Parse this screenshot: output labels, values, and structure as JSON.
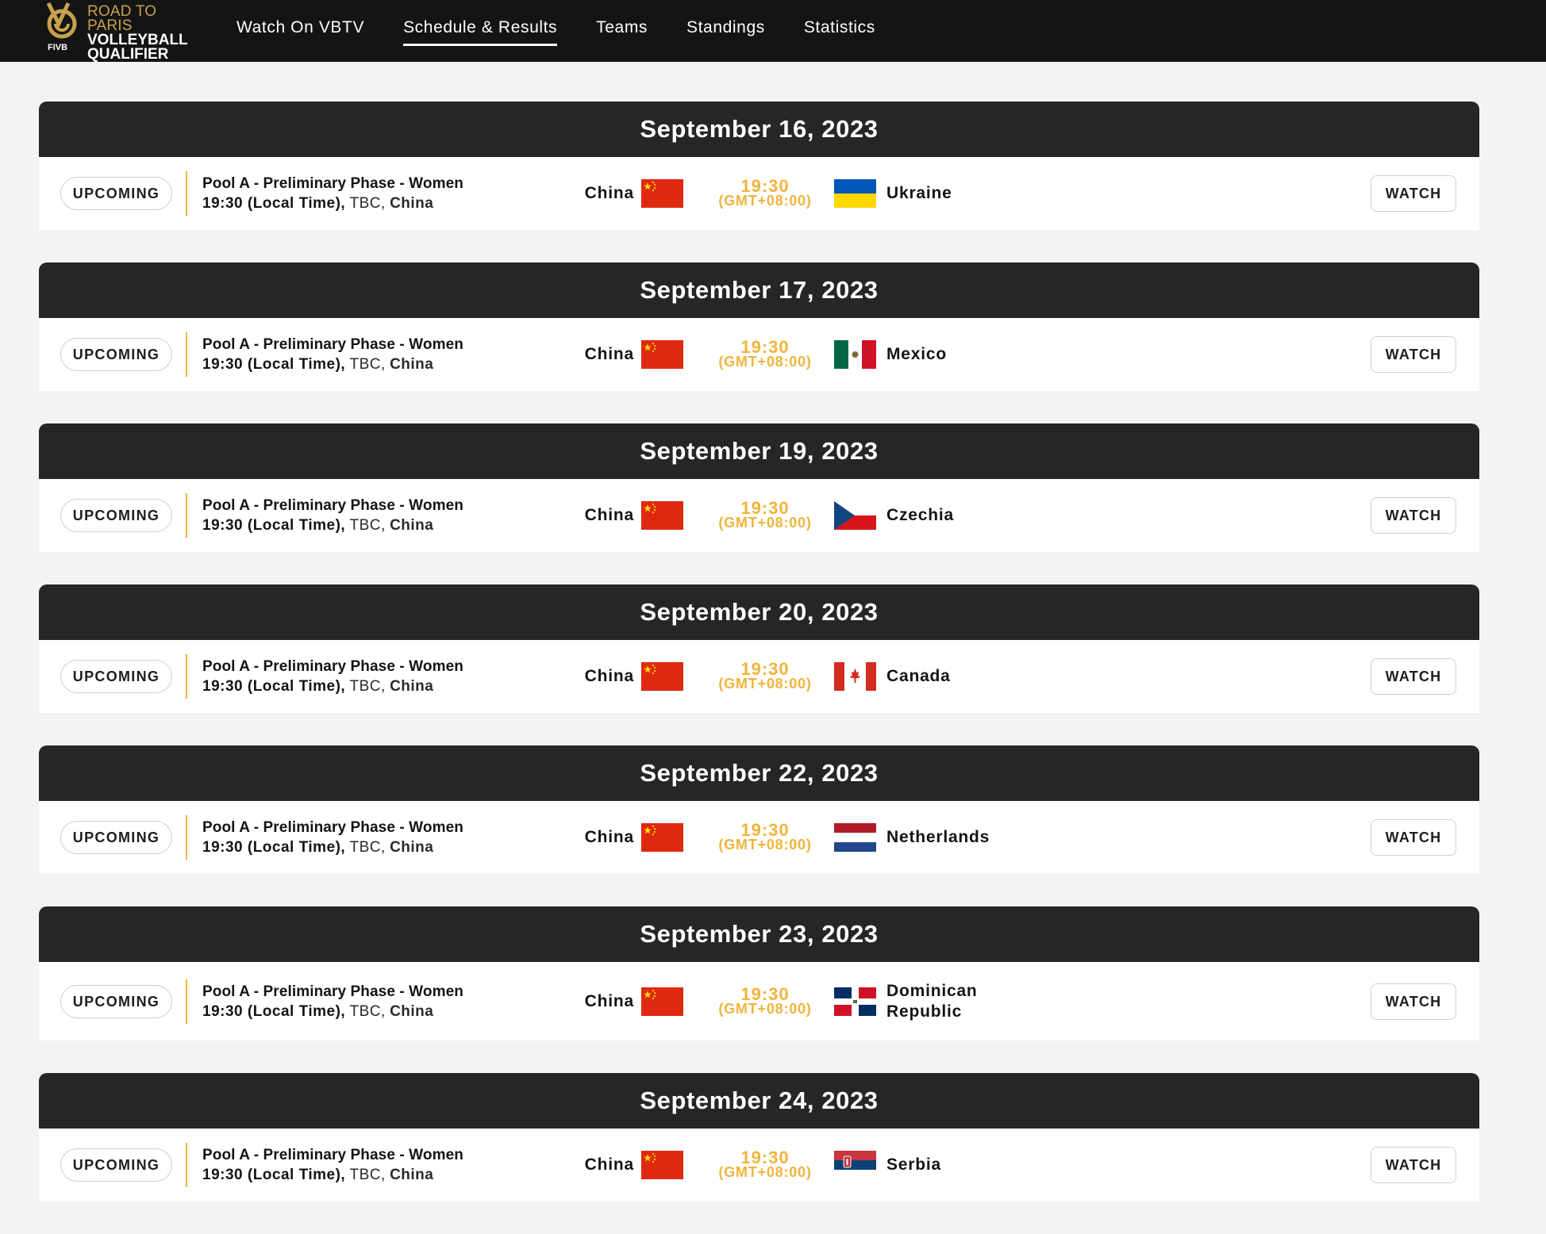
{
  "header": {
    "logo": {
      "line1": "ROAD TO PARIS",
      "line2": "VOLLEYBALL",
      "line3": "QUALIFIER",
      "badge": "FIVB"
    },
    "nav": [
      {
        "label": "Watch On VBTV",
        "active": false
      },
      {
        "label": "Schedule & Results",
        "active": true
      },
      {
        "label": "Teams",
        "active": false
      },
      {
        "label": "Standings",
        "active": false
      },
      {
        "label": "Statistics",
        "active": false
      }
    ]
  },
  "colors": {
    "accent": "#f0b43c",
    "header_bg": "#141414",
    "day_header_bg": "#262626",
    "page_bg": "#f3f3f3"
  },
  "days": [
    {
      "date": "September 16, 2023",
      "match": {
        "status": "UPCOMING",
        "phase": "Pool A - Preliminary Phase - Women",
        "local_time": "19:30 (Local Time),",
        "venue": "TBC,",
        "city": "China",
        "home": "China",
        "home_flag": "china-flag-icon",
        "kickoff": "19:30",
        "timezone": "(GMT+08:00)",
        "away": "Ukraine",
        "away_flag": "ukraine-flag-icon",
        "action": "WATCH"
      }
    },
    {
      "date": "September 17, 2023",
      "match": {
        "status": "UPCOMING",
        "phase": "Pool A - Preliminary Phase - Women",
        "local_time": "19:30 (Local Time),",
        "venue": "TBC,",
        "city": "China",
        "home": "China",
        "home_flag": "china-flag-icon",
        "kickoff": "19:30",
        "timezone": "(GMT+08:00)",
        "away": "Mexico",
        "away_flag": "mexico-flag-icon",
        "action": "WATCH"
      }
    },
    {
      "date": "September 19, 2023",
      "match": {
        "status": "UPCOMING",
        "phase": "Pool A - Preliminary Phase - Women",
        "local_time": "19:30 (Local Time),",
        "venue": "TBC,",
        "city": "China",
        "home": "China",
        "home_flag": "china-flag-icon",
        "kickoff": "19:30",
        "timezone": "(GMT+08:00)",
        "away": "Czechia",
        "away_flag": "czechia-flag-icon",
        "action": "WATCH"
      }
    },
    {
      "date": "September 20, 2023",
      "match": {
        "status": "UPCOMING",
        "phase": "Pool A - Preliminary Phase - Women",
        "local_time": "19:30 (Local Time),",
        "venue": "TBC,",
        "city": "China",
        "home": "China",
        "home_flag": "china-flag-icon",
        "kickoff": "19:30",
        "timezone": "(GMT+08:00)",
        "away": "Canada",
        "away_flag": "canada-flag-icon",
        "action": "WATCH"
      }
    },
    {
      "date": "September 22, 2023",
      "match": {
        "status": "UPCOMING",
        "phase": "Pool A - Preliminary Phase - Women",
        "local_time": "19:30 (Local Time),",
        "venue": "TBC,",
        "city": "China",
        "home": "China",
        "home_flag": "china-flag-icon",
        "kickoff": "19:30",
        "timezone": "(GMT+08:00)",
        "away": "Netherlands",
        "away_flag": "netherlands-flag-icon",
        "action": "WATCH"
      }
    },
    {
      "date": "September 23, 2023",
      "match": {
        "status": "UPCOMING",
        "phase": "Pool A - Preliminary Phase - Women",
        "local_time": "19:30 (Local Time),",
        "venue": "TBC,",
        "city": "China",
        "home": "China",
        "home_flag": "china-flag-icon",
        "kickoff": "19:30",
        "timezone": "(GMT+08:00)",
        "away": "Dominican Republic",
        "away_flag": "dominican-republic-flag-icon",
        "action": "WATCH"
      }
    },
    {
      "date": "September 24, 2023",
      "match": {
        "status": "UPCOMING",
        "phase": "Pool A - Preliminary Phase - Women",
        "local_time": "19:30 (Local Time),",
        "venue": "TBC,",
        "city": "China",
        "home": "China",
        "home_flag": "china-flag-icon",
        "kickoff": "19:30",
        "timezone": "(GMT+08:00)",
        "away": "Serbia",
        "away_flag": "serbia-flag-icon",
        "action": "WATCH"
      }
    }
  ]
}
